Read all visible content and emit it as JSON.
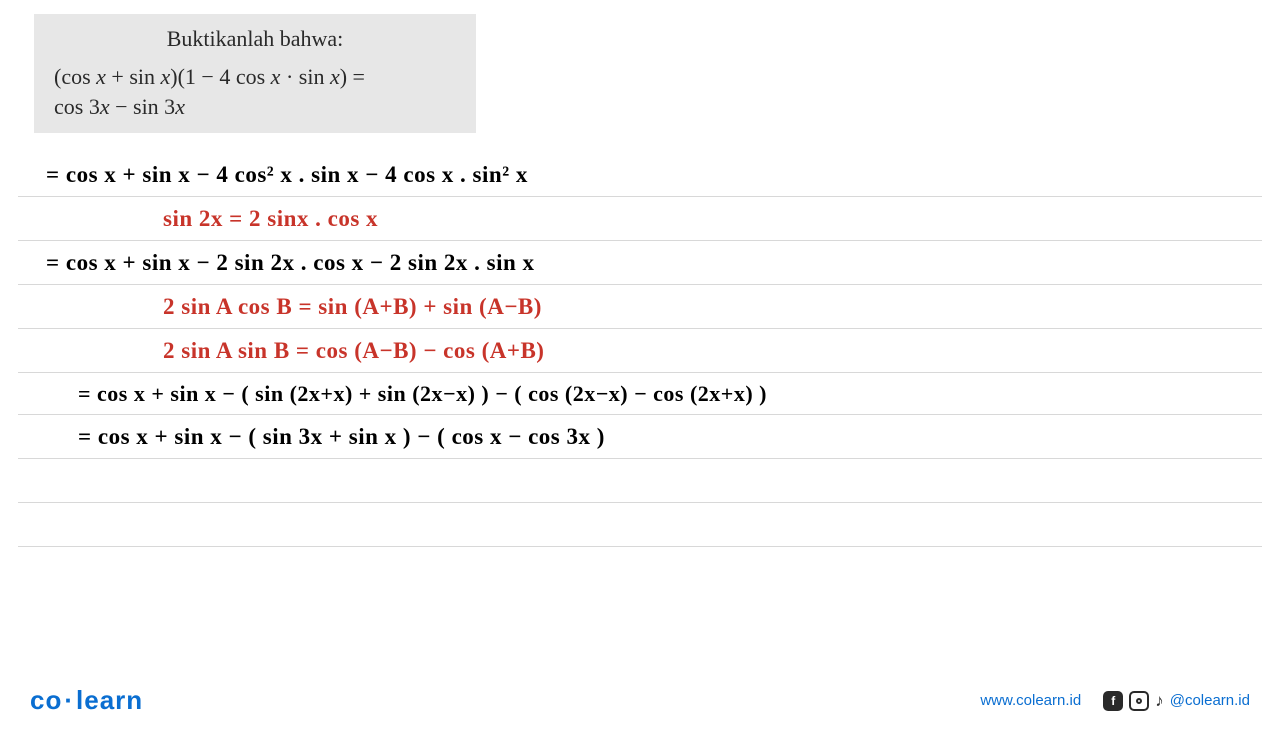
{
  "problem": {
    "title": "Buktikanlah bahwa:",
    "line1": "(cos x + sin x)(1 − 4 cos x · sin x) =",
    "line2": "cos 3x − sin 3x"
  },
  "work": {
    "l1": "= cos x + sin x − 4 cos² x . sin x − 4 cos x . sin² x",
    "l2": "sin 2x = 2 sinx . cos x",
    "l3": "= cos x + sin x − 2 sin 2x . cos x − 2 sin 2x . sin x",
    "l4": "2 sin A cos B  =  sin (A+B) + sin (A−B)",
    "l5": "2 sin A sin B  =  cos (A−B) − cos (A+B)",
    "l6": "= cos x + sin x − ( sin (2x+x) + sin (2x−x) ) − ( cos (2x−x) − cos (2x+x) )",
    "l7": "= cos x + sin x − ( sin 3x + sin x ) − ( cos x − cos 3x )"
  },
  "footer": {
    "logo_left": "co",
    "logo_right": "learn",
    "url": "www.colearn.id",
    "handle": "@colearn.id"
  }
}
